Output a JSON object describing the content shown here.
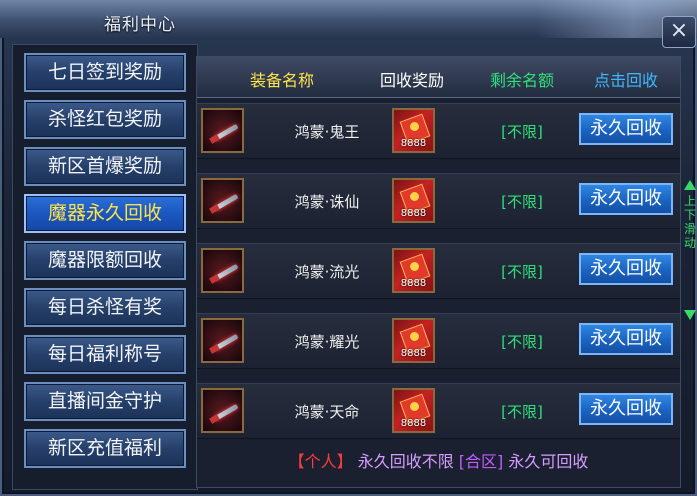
{
  "window": {
    "title": "福利中心",
    "close_icon": "×"
  },
  "sidebar": {
    "items": [
      {
        "label": "七日签到奖励",
        "active": false
      },
      {
        "label": "杀怪红包奖励",
        "active": false
      },
      {
        "label": "新区首爆奖励",
        "active": false
      },
      {
        "label": "魔器永久回收",
        "active": true
      },
      {
        "label": "魔器限额回收",
        "active": false
      },
      {
        "label": "每日杀怪有奖",
        "active": false
      },
      {
        "label": "每日福利称号",
        "active": false
      },
      {
        "label": "直播间金守护",
        "active": false
      },
      {
        "label": "新区充值福利",
        "active": false
      }
    ]
  },
  "table": {
    "headers": [
      "装备名称",
      "回收奖励",
      "剩余名额",
      "点击回收"
    ],
    "header_colors": [
      "#ffe34a",
      "#ffffff",
      "#2fe07a",
      "#3fb8ff"
    ],
    "rows": [
      {
        "name": "鸿蒙·鬼王",
        "reward": "8888",
        "quota": "[不限]",
        "button": "永久回收"
      },
      {
        "name": "鸿蒙·诛仙",
        "reward": "8888",
        "quota": "[不限]",
        "button": "永久回收"
      },
      {
        "name": "鸿蒙·流光",
        "reward": "8888",
        "quota": "[不限]",
        "button": "永久回收"
      },
      {
        "name": "鸿蒙·耀光",
        "reward": "8888",
        "quota": "[不限]",
        "button": "永久回收"
      },
      {
        "name": "鸿蒙·天命",
        "reward": "8888",
        "quota": "[不限]",
        "button": "永久回收"
      }
    ]
  },
  "footer": {
    "part1": "【个人】",
    "part2": "永久回收不限",
    "part3": "[合区]",
    "part4": "永久可回收",
    "colors": [
      "#ff3b3b",
      "#d59cff",
      "#c25cff",
      "#d59cff"
    ]
  },
  "scroll_hint": {
    "text": "上下滑动",
    "color": "#3bd86a"
  }
}
